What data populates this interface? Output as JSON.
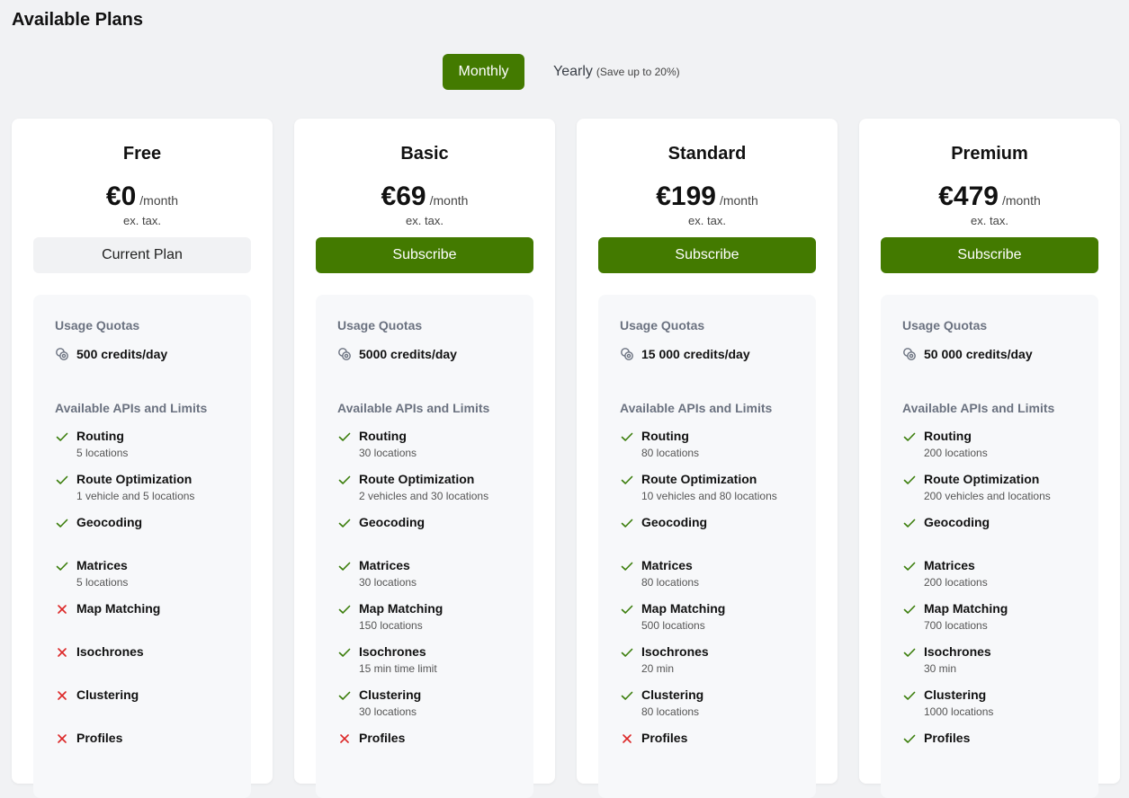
{
  "page_title": "Available Plans",
  "billing_toggle": {
    "monthly_label": "Monthly",
    "yearly_label": "Yearly",
    "yearly_note": "(Save up to 20%)",
    "selected": "Monthly"
  },
  "colors": {
    "accent": "#437a00",
    "check": "#3a7d0a",
    "cross": "#dc2626",
    "muted": "#6b7280"
  },
  "labels": {
    "usage_quotas": "Usage Quotas",
    "apis_heading": "Available APIs and Limits"
  },
  "plans": [
    {
      "name": "Free",
      "price": "€0",
      "period": "/month",
      "tax": "ex. tax.",
      "button": "Current Plan",
      "button_type": "current",
      "credits": "500 credits/day",
      "apis": [
        {
          "name": "Routing",
          "limit": "5 locations",
          "available": true
        },
        {
          "name": "Route Optimization",
          "limit": "1 vehicle and 5 locations",
          "available": true
        },
        {
          "name": "Geocoding",
          "limit": "",
          "available": true
        },
        {
          "name": "Matrices",
          "limit": "5 locations",
          "available": true
        },
        {
          "name": "Map Matching",
          "limit": "",
          "available": false
        },
        {
          "name": "Isochrones",
          "limit": "",
          "available": false
        },
        {
          "name": "Clustering",
          "limit": "",
          "available": false
        },
        {
          "name": "Profiles",
          "limit": "",
          "available": false
        }
      ]
    },
    {
      "name": "Basic",
      "price": "€69",
      "period": "/month",
      "tax": "ex. tax.",
      "button": "Subscribe",
      "button_type": "subscribe",
      "credits": "5000 credits/day",
      "apis": [
        {
          "name": "Routing",
          "limit": "30 locations",
          "available": true
        },
        {
          "name": "Route Optimization",
          "limit": "2 vehicles and 30 locations",
          "available": true
        },
        {
          "name": "Geocoding",
          "limit": "",
          "available": true
        },
        {
          "name": "Matrices",
          "limit": "30 locations",
          "available": true
        },
        {
          "name": "Map Matching",
          "limit": "150 locations",
          "available": true
        },
        {
          "name": "Isochrones",
          "limit": "15 min time limit",
          "available": true
        },
        {
          "name": "Clustering",
          "limit": "30 locations",
          "available": true
        },
        {
          "name": "Profiles",
          "limit": "",
          "available": false
        }
      ]
    },
    {
      "name": "Standard",
      "price": "€199",
      "period": "/month",
      "tax": "ex. tax.",
      "button": "Subscribe",
      "button_type": "subscribe",
      "credits": "15 000 credits/day",
      "apis": [
        {
          "name": "Routing",
          "limit": "80 locations",
          "available": true
        },
        {
          "name": "Route Optimization",
          "limit": "10 vehicles and 80 locations",
          "available": true
        },
        {
          "name": "Geocoding",
          "limit": "",
          "available": true
        },
        {
          "name": "Matrices",
          "limit": "80 locations",
          "available": true
        },
        {
          "name": "Map Matching",
          "limit": "500 locations",
          "available": true
        },
        {
          "name": "Isochrones",
          "limit": "20 min",
          "available": true
        },
        {
          "name": "Clustering",
          "limit": "80 locations",
          "available": true
        },
        {
          "name": "Profiles",
          "limit": "",
          "available": false
        }
      ]
    },
    {
      "name": "Premium",
      "price": "€479",
      "period": "/month",
      "tax": "ex. tax.",
      "button": "Subscribe",
      "button_type": "subscribe",
      "credits": "50 000 credits/day",
      "apis": [
        {
          "name": "Routing",
          "limit": "200 locations",
          "available": true
        },
        {
          "name": "Route Optimization",
          "limit": "200 vehicles and locations",
          "available": true
        },
        {
          "name": "Geocoding",
          "limit": "",
          "available": true
        },
        {
          "name": "Matrices",
          "limit": "200 locations",
          "available": true
        },
        {
          "name": "Map Matching",
          "limit": "700 locations",
          "available": true
        },
        {
          "name": "Isochrones",
          "limit": "30 min",
          "available": true
        },
        {
          "name": "Clustering",
          "limit": "1000 locations",
          "available": true
        },
        {
          "name": "Profiles",
          "limit": "",
          "available": true
        }
      ]
    }
  ]
}
